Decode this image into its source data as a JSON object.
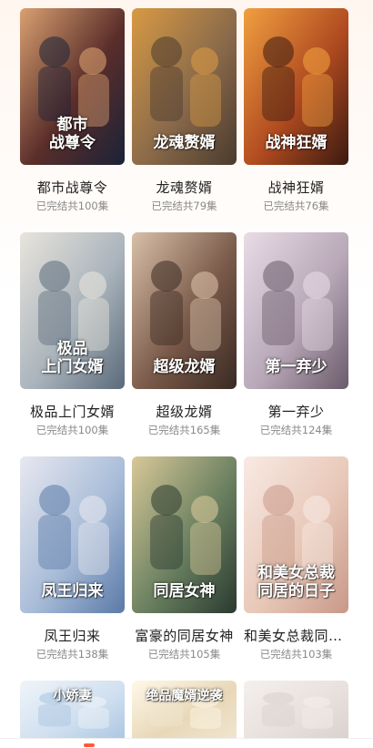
{
  "dramas": [
    {
      "title": "都市战尊令",
      "status": "已完结共100集",
      "poster_text": "都市\n战尊令",
      "colors": [
        "#1a2238",
        "#5a2e2a",
        "#d9a070"
      ]
    },
    {
      "title": "龙魂赘婿",
      "status": "已完结共79集",
      "poster_text": "龙魂赘婿",
      "colors": [
        "#4a3a2e",
        "#8a6a4a",
        "#d89a44"
      ]
    },
    {
      "title": "战神狂婿",
      "status": "已完结共76集",
      "poster_text": "战神狂婿",
      "colors": [
        "#3a1a10",
        "#b04a20",
        "#f0a040"
      ]
    },
    {
      "title": "极品上门女婿",
      "status": "已完结共100集",
      "poster_text": "极品\n上门女婿",
      "colors": [
        "#5a6a7a",
        "#aab4bc",
        "#e8e4dc"
      ]
    },
    {
      "title": "超级龙婿",
      "status": "已完结共165集",
      "poster_text": "超级龙婿",
      "colors": [
        "#3a2a22",
        "#7a5a4a",
        "#d8c0a8"
      ]
    },
    {
      "title": "第一弃少",
      "status": "已完结共124集",
      "poster_text": "第一弃少",
      "colors": [
        "#6a5a6a",
        "#b8a8b8",
        "#e8dce6"
      ]
    },
    {
      "title": "凤王归来",
      "status": "已完结共138集",
      "poster_text": "凤王归来",
      "colors": [
        "#5a7aa8",
        "#a8bcd8",
        "#e8e8f0"
      ]
    },
    {
      "title": "富豪的同居女神",
      "status": "已完结共105集",
      "poster_text": "同居女神",
      "colors": [
        "#2a3a30",
        "#6a8060",
        "#d8c898"
      ]
    },
    {
      "title": "和美女总裁同居...",
      "status": "已完结共103集",
      "poster_text": "和美女总裁\n同居的日子",
      "colors": [
        "#c89888",
        "#e8c8b8",
        "#f8eae4"
      ]
    },
    {
      "title": "",
      "status": "",
      "poster_text": "小娇妻",
      "colors": [
        "#a8c4e0",
        "#d0e0f0",
        "#f0f4f8"
      ]
    },
    {
      "title": "",
      "status": "",
      "poster_text": "绝品魔婿逆袭",
      "colors": [
        "#f0e6d0",
        "#e8d8b8",
        "#fff8e8"
      ]
    },
    {
      "title": "",
      "status": "",
      "poster_text": "",
      "colors": [
        "#d8d0cc",
        "#e8e0dc",
        "#f4f0ee"
      ]
    }
  ],
  "accent": "#ff5a3c"
}
